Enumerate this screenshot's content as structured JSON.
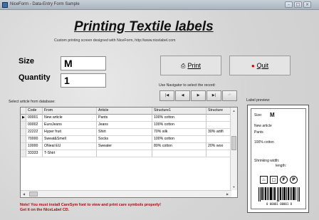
{
  "window": {
    "title": "NiceForm - Data-Entry Form Sample",
    "buttons": [
      "–",
      "□",
      "×"
    ]
  },
  "heading": "Printing Textile labels",
  "subtitle": "Custom printing screen designed with NiceForm, http://www.nicelabel.com",
  "size": {
    "label": "Size",
    "value": "M"
  },
  "quantity": {
    "label": "Quantity",
    "value": "1"
  },
  "print_button": {
    "label": "Print",
    "icon": "printer-icon"
  },
  "quit_button": {
    "label": "Quit",
    "icon": "stop-icon"
  },
  "navigator": {
    "caption": "Use Navigator to select the record:",
    "buttons": [
      "|◀",
      "◀",
      "▶",
      "▶|",
      "↶"
    ]
  },
  "grid": {
    "caption": "Select article from database:",
    "columns": [
      "Code",
      "From",
      "Article",
      "Structure1",
      "Structure"
    ],
    "rows": [
      [
        "00001",
        "New article",
        "Pants",
        "100% cotton",
        ""
      ],
      [
        "00002",
        "EuroJeans",
        "Jeans",
        "100% cotton",
        ""
      ],
      [
        "22222",
        "Hyper fruit",
        "Shirt",
        "70% silk",
        "30% artifi"
      ],
      [
        "70000",
        "Sweat&Smell",
        "Socks",
        "100% cotton",
        ""
      ],
      [
        "10000",
        "ONeal EU",
        "Sweater",
        "80% cotton",
        "20% woo"
      ],
      [
        "33333",
        "T-Shirt",
        "",
        "",
        ""
      ]
    ],
    "selected_row": 0
  },
  "note": {
    "line1": "Note! You must install CareSym font to view and print care symbols properly!",
    "line2": "Get it on the NiceLabel CD."
  },
  "preview": {
    "caption": "Label preview:",
    "size_label": "Size:",
    "size_value": "M",
    "article_from": "New article",
    "article": "Pants",
    "structure": "100% cotton",
    "shrinking_width": "Shrinking width:",
    "shrinking_length": "length:",
    "care_symbols": [
      "wash-icon",
      "dry-icon",
      "iron-icon",
      "dryclean-icon"
    ],
    "barcode_text": "0 00001 00001 8"
  },
  "colors": {
    "note": "#a01010",
    "desktop": "#2a7a9a"
  }
}
